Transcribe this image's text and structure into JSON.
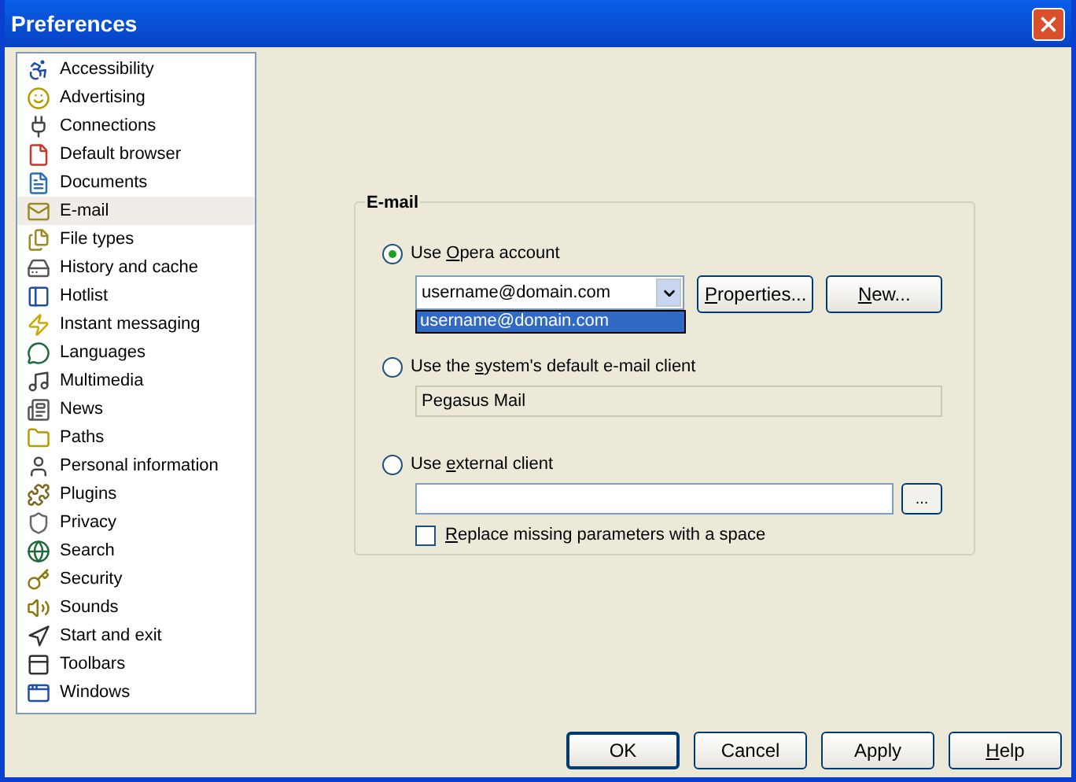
{
  "window": {
    "title": "Preferences"
  },
  "sidebar": {
    "items": [
      {
        "label": "Accessibility",
        "selected": false
      },
      {
        "label": "Advertising",
        "selected": false
      },
      {
        "label": "Connections",
        "selected": false
      },
      {
        "label": "Default browser",
        "selected": false
      },
      {
        "label": "Documents",
        "selected": false
      },
      {
        "label": "E-mail",
        "selected": true
      },
      {
        "label": "File types",
        "selected": false
      },
      {
        "label": "History and cache",
        "selected": false
      },
      {
        "label": "Hotlist",
        "selected": false
      },
      {
        "label": "Instant messaging",
        "selected": false
      },
      {
        "label": "Languages",
        "selected": false
      },
      {
        "label": "Multimedia",
        "selected": false
      },
      {
        "label": "News",
        "selected": false
      },
      {
        "label": "Paths",
        "selected": false
      },
      {
        "label": "Personal information",
        "selected": false
      },
      {
        "label": "Plugins",
        "selected": false
      },
      {
        "label": "Privacy",
        "selected": false
      },
      {
        "label": "Search",
        "selected": false
      },
      {
        "label": "Security",
        "selected": false
      },
      {
        "label": "Sounds",
        "selected": false
      },
      {
        "label": "Start and exit",
        "selected": false
      },
      {
        "label": "Toolbars",
        "selected": false
      },
      {
        "label": "Windows",
        "selected": false
      }
    ]
  },
  "email_group": {
    "title": "E-mail",
    "options": [
      {
        "kind": "account",
        "label_parts": [
          {
            "text": "Use ",
            "underlined": false
          },
          {
            "text": "O",
            "underlined": true
          },
          {
            "text": "pera account",
            "underlined": false
          }
        ],
        "selected": true,
        "account": {
          "value": "username@domain.com",
          "expanded": true,
          "list": [
            {
              "label": "username@domain.com",
              "selected": true
            }
          ]
        },
        "buttons": [
          {
            "label_parts": [
              {
                "text": "P",
                "underlined": true
              },
              {
                "text": "roperties...",
                "underlined": false
              }
            ]
          },
          {
            "label_parts": [
              {
                "text": "N",
                "underlined": true
              },
              {
                "text": "ew...",
                "underlined": false
              }
            ]
          }
        ]
      },
      {
        "kind": "system",
        "label_parts": [
          {
            "text": "Use the ",
            "underlined": false
          },
          {
            "text": "s",
            "underlined": true
          },
          {
            "text": "ystem's default e-mail client",
            "underlined": false
          }
        ],
        "selected": false,
        "value": "Pegasus Mail"
      },
      {
        "kind": "external",
        "label_parts": [
          {
            "text": "Use ",
            "underlined": false
          },
          {
            "text": "e",
            "underlined": true
          },
          {
            "text": "xternal client",
            "underlined": false
          }
        ],
        "selected": false,
        "browse": "...",
        "checkbox": {
          "label_parts": [
            {
              "text": "R",
              "underlined": true
            },
            {
              "text": "eplace missing parameters with a space",
              "underlined": false
            }
          ],
          "checked": false
        }
      }
    ]
  },
  "buttons": [
    {
      "label_parts": [
        {
          "text": "OK",
          "underlined": false
        }
      ],
      "default": true
    },
    {
      "label_parts": [
        {
          "text": "Cancel",
          "underlined": false
        }
      ],
      "default": false
    },
    {
      "label_parts": [
        {
          "text": "Apply",
          "underlined": false
        }
      ],
      "default": false
    },
    {
      "label_parts": [
        {
          "text": "H",
          "underlined": true
        },
        {
          "text": "elp",
          "underlined": false
        }
      ],
      "default": false
    }
  ]
}
